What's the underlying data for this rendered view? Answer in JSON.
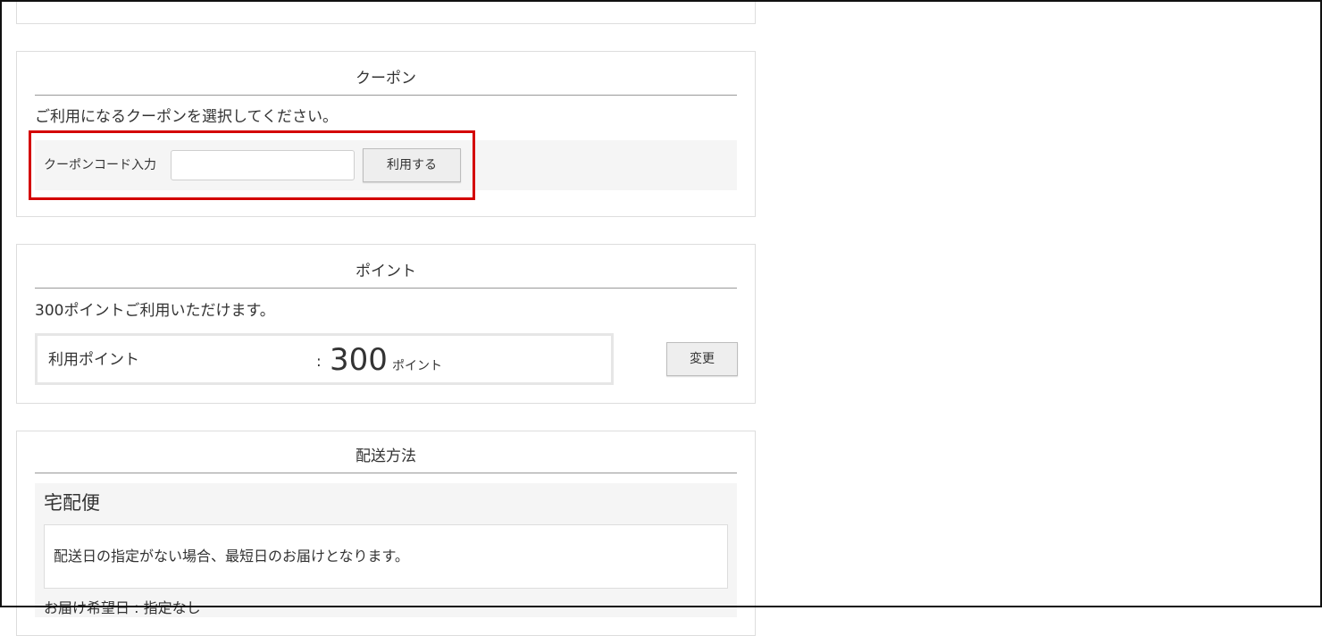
{
  "coupon": {
    "title": "クーポン",
    "description": "ご利用になるクーポンを選択してください。",
    "code_label": "クーポンコード入力",
    "code_value": "",
    "apply_button": "利用する"
  },
  "points": {
    "title": "ポイント",
    "description": "300ポイントご利用いただけます。",
    "use_label": "利用ポイント",
    "separator": ":",
    "value": "300",
    "unit": "ポイント",
    "change_button": "変更"
  },
  "delivery": {
    "title": "配送方法",
    "method": "宅配便",
    "note": "配送日の指定がない場合、最短日のお届けとなります。",
    "date_label": "お届け希望日 :  指定なし"
  },
  "colors": {
    "highlight": "#d40000",
    "panel_border": "#dddddd",
    "band": "#f5f5f5"
  }
}
